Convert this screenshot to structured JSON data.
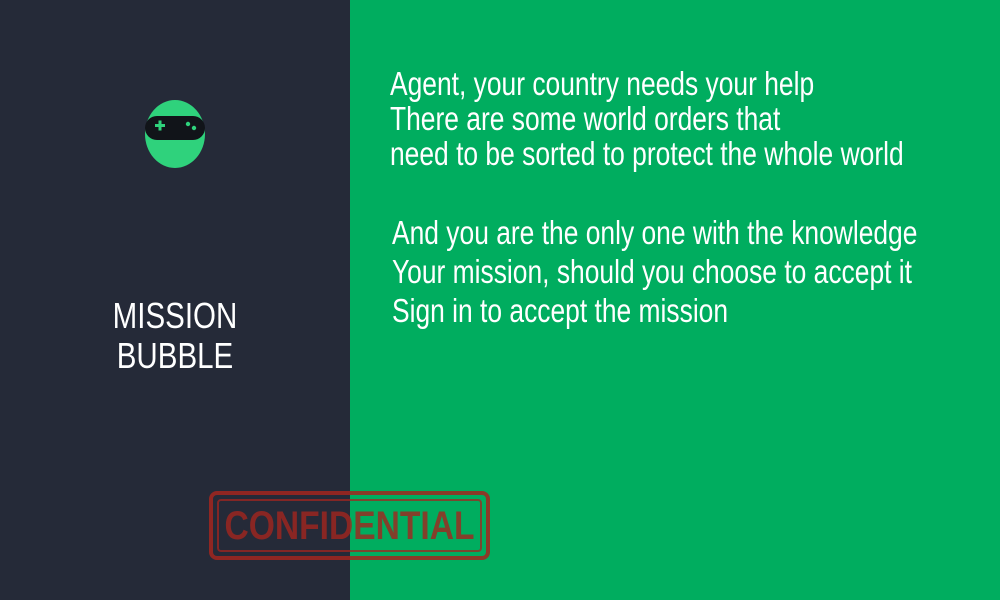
{
  "brand": {
    "line1": "MISSION",
    "line2": "BUBBLE",
    "logo_icon": "ninja-gamepad-icon"
  },
  "message": {
    "paragraph1": [
      "Agent, your country needs your help",
      "There are some world orders that",
      "need to be sorted to protect the whole world"
    ],
    "paragraph2": [
      "And you are the only one with the knowledge",
      "Your mission, should you choose to accept it",
      "Sign in to accept the mission"
    ]
  },
  "stamp": {
    "text": "CONFIDENTIAL",
    "icon": "confidential-stamp"
  },
  "colors": {
    "left_panel": "#252a38",
    "right_panel": "#00ad5f",
    "logo_green": "#2fd27c",
    "stamp_red": "#a3261f"
  }
}
